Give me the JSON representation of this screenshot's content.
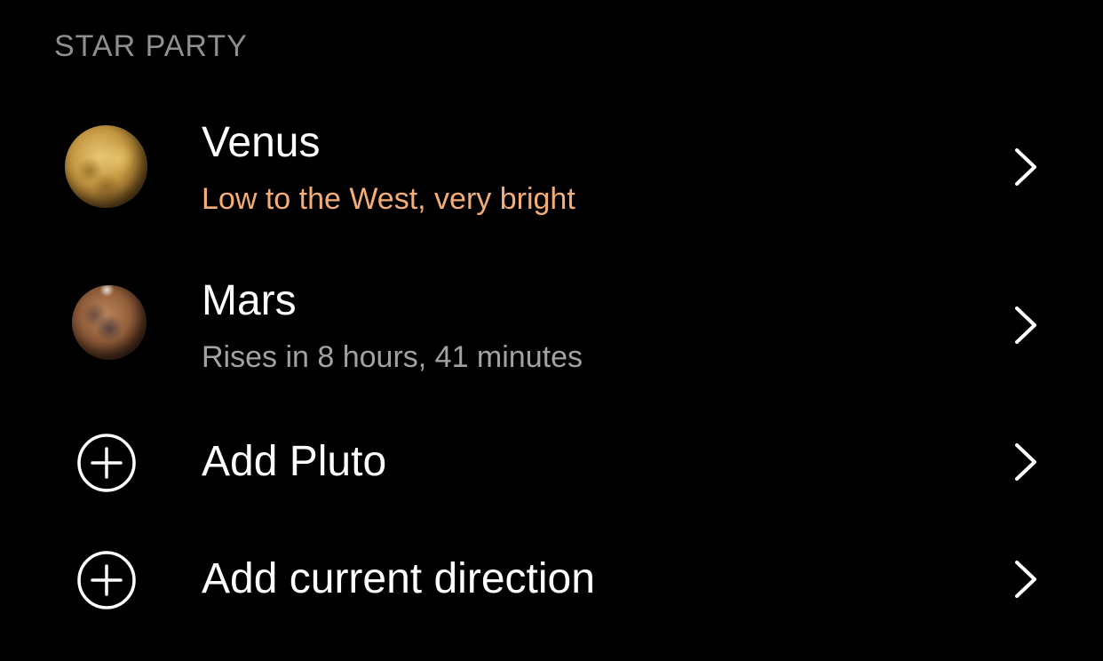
{
  "section": {
    "title": "STAR PARTY"
  },
  "items": [
    {
      "title": "Venus",
      "subtitle": "Low to the West, very bright",
      "subtitle_color": "#f4ad74",
      "icon": "venus-planet-image"
    },
    {
      "title": "Mars",
      "subtitle": "Rises in 8 hours, 41 minutes",
      "subtitle_color": "#a2a2a6",
      "icon": "mars-planet-image"
    }
  ],
  "actions": [
    {
      "label": "Add Pluto",
      "icon": "plus-circle-icon"
    },
    {
      "label": "Add current direction",
      "icon": "plus-circle-icon"
    }
  ],
  "colors": {
    "background": "#000000",
    "header": "#8e8e93",
    "text": "#ffffff",
    "accent": "#f4ad74"
  },
  "disclosure_icon": "chevron-right-icon"
}
